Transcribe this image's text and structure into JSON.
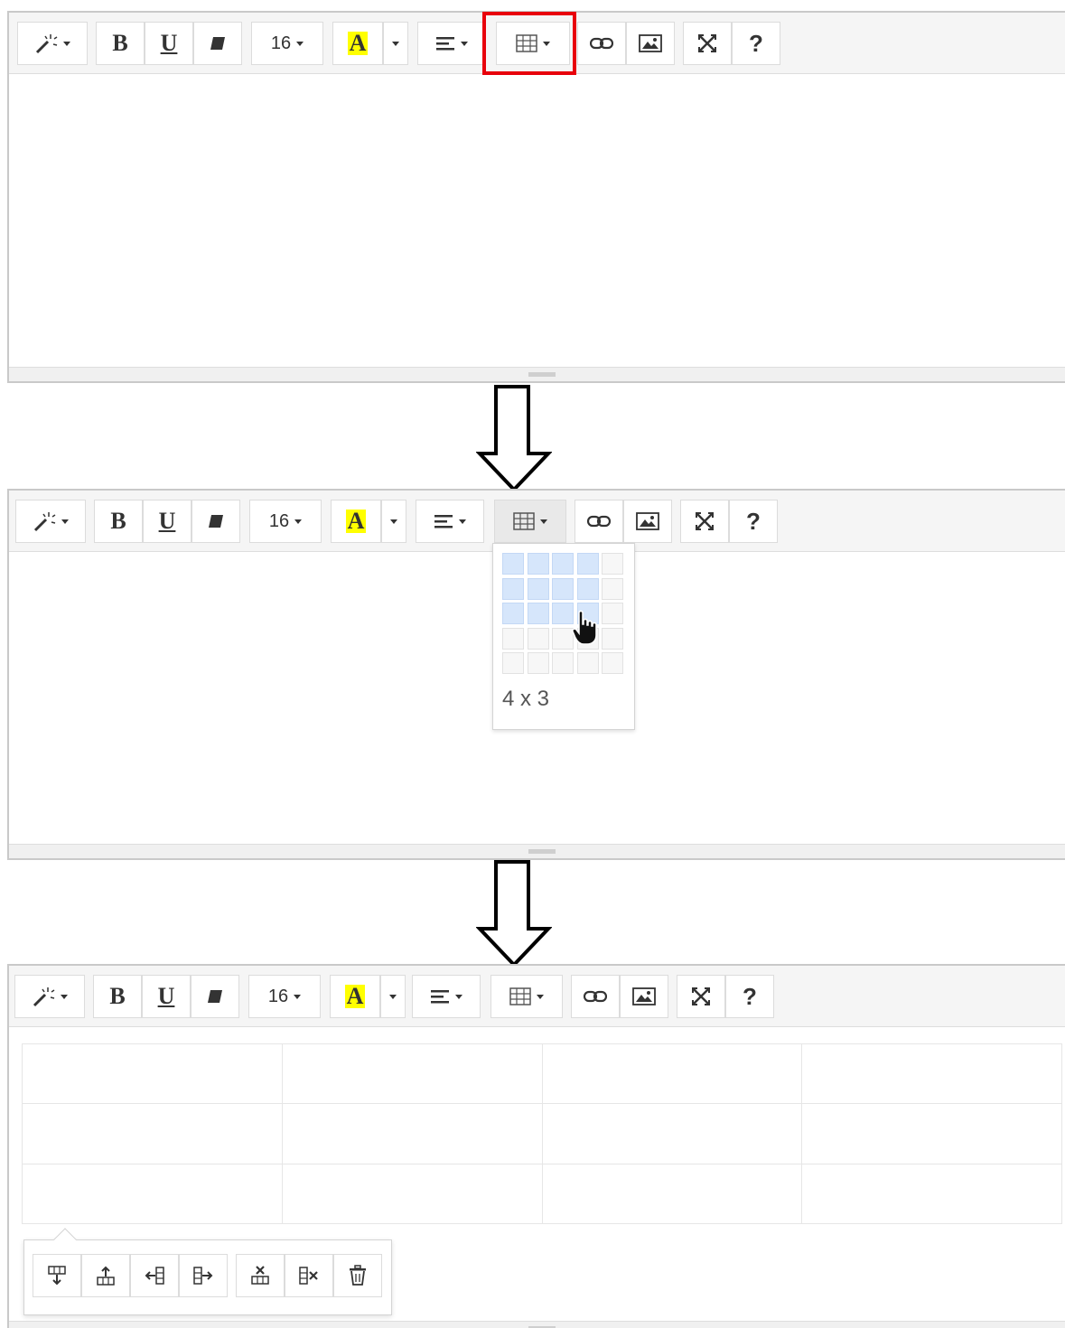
{
  "toolbar": {
    "style_icon": "magic-wand-icon",
    "bold_label": "B",
    "underline_label": "U",
    "clear_format_icon": "eraser-icon",
    "font_size_value": "16",
    "color_label": "A",
    "color_highlight": "#ffff00",
    "align_icon": "align-icon",
    "table_icon": "table-grid-icon",
    "link_icon": "link-icon",
    "image_icon": "picture-icon",
    "fullscreen_icon": "fullscreen-icon",
    "help_label": "?"
  },
  "table_picker": {
    "dimension_label": "4 x 3",
    "selected_columns": 4,
    "selected_rows": 3,
    "grid_columns": 5,
    "grid_rows": 5
  },
  "inserted_table": {
    "columns": 4,
    "rows": 3
  },
  "table_popover": {
    "buttons": [
      {
        "icon": "add-row-below-icon"
      },
      {
        "icon": "add-row-above-icon"
      },
      {
        "icon": "add-column-left-icon"
      },
      {
        "icon": "add-column-right-icon"
      },
      {
        "icon": "delete-row-icon"
      },
      {
        "icon": "delete-column-icon"
      },
      {
        "icon": "delete-table-icon"
      }
    ]
  },
  "colors": {
    "highlight_border": "#e8000b",
    "picker_selected": "#d6e6fb",
    "toolbar_bg": "#f5f5f5"
  }
}
